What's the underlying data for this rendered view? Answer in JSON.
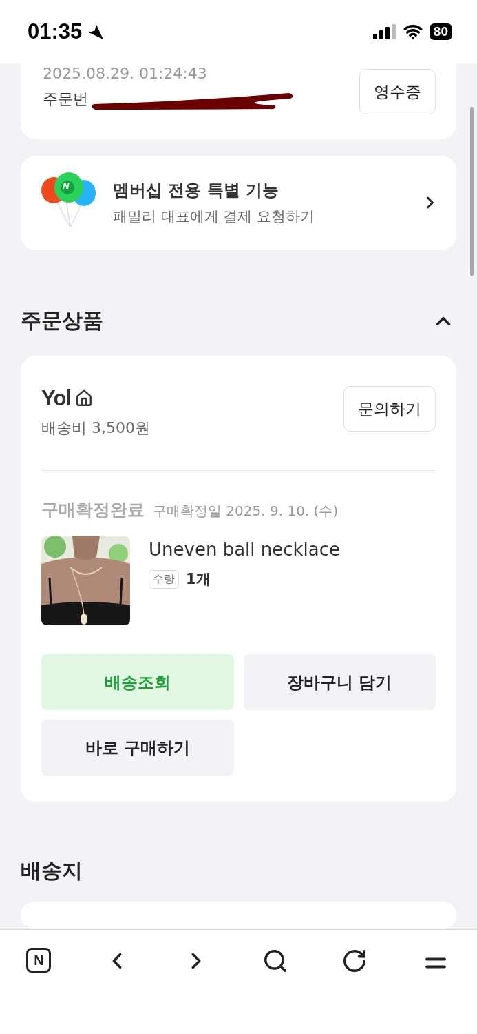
{
  "status_bar": {
    "time": "01:35",
    "battery": "80"
  },
  "order_card": {
    "datetime": "2025.08.29. 01:24:43",
    "order_number_label": "주문번",
    "receipt_button": "영수증"
  },
  "membership": {
    "logo_letter": "N",
    "title": "멤버십 전용 특별 기능",
    "subtitle": "패밀리 대표에게 결제 요청하기"
  },
  "ordered_items": {
    "title": "주문상품",
    "expanded": true,
    "store": {
      "name": "Yol",
      "shipping_fee": "배송비 3,500원",
      "inquiry_button": "문의하기"
    },
    "status": "구매확정완료",
    "confirm_date": "구매확정일 2025. 9. 10. (수)",
    "product": {
      "kind": "picture",
      "name": "Uneven ball necklace",
      "quantity_label": "수량",
      "quantity": "1개"
    },
    "actions": [
      {
        "label": "배송조회",
        "kind": "primary"
      },
      {
        "label": "장바구니 담기",
        "kind": "secondary"
      },
      {
        "label": "바로 구매하기",
        "kind": "secondary"
      }
    ]
  },
  "shipping": {
    "title": "배송지"
  },
  "bottom_nav": [
    {
      "kind": "home",
      "letter": "N"
    },
    {
      "kind": "back"
    },
    {
      "kind": "forward"
    },
    {
      "kind": "search"
    },
    {
      "kind": "reload"
    },
    {
      "kind": "menu"
    }
  ]
}
